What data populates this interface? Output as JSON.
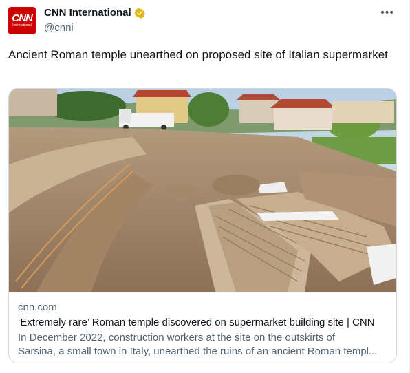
{
  "author": {
    "avatar_main": "CNN",
    "avatar_sub": "International",
    "display_name": "CNN International",
    "handle": "@cnni",
    "verified_icon": "gold-verified-badge-icon",
    "verified_color": "#e2b719"
  },
  "menu": {
    "more_label": "•••"
  },
  "tweet": {
    "text": "Ancient Roman temple unearthed on proposed site of Italian supermarket"
  },
  "card": {
    "image_description_icon": "excavation-photo",
    "domain": "cnn.com",
    "title": "‘Extremely rare’ Roman temple discovered on supermarket building site | CNN",
    "desc_line1": "In December 2022, construction workers at the site on the outskirts of",
    "desc_line2": "Sarsina, a small town in Italy, unearthed the ruins of an ancient Roman templ..."
  },
  "colors": {
    "brand_red": "#cc0000",
    "text_primary": "#0f1419",
    "text_secondary": "#536471",
    "border": "#cfd9de"
  }
}
